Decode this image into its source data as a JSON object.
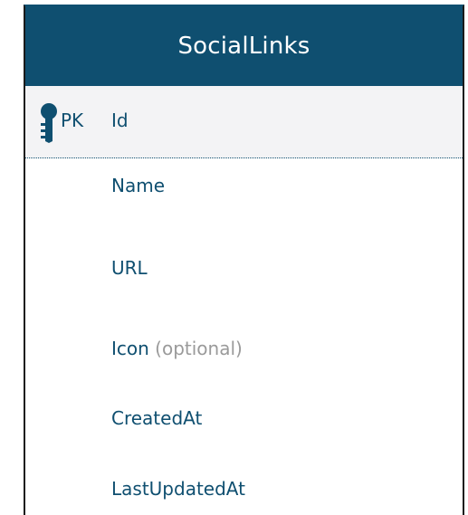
{
  "entity": {
    "title": "SocialLinks",
    "primary_key": {
      "marker": "PK",
      "icon": "key-icon",
      "name": "Id"
    },
    "fields": [
      {
        "name": "Name",
        "suffix": ""
      },
      {
        "name": "URL",
        "suffix": ""
      },
      {
        "name": "Icon",
        "suffix": " (optional)"
      },
      {
        "name": "CreatedAt",
        "suffix": ""
      },
      {
        "name": "LastUpdatedAt",
        "suffix": ""
      }
    ]
  },
  "colors": {
    "header_bg": "#0f4f70",
    "header_text": "#ffffff",
    "field_text": "#0f4f70",
    "optional_text": "#9a9a9a",
    "pk_row_bg": "#f3f3f5"
  }
}
